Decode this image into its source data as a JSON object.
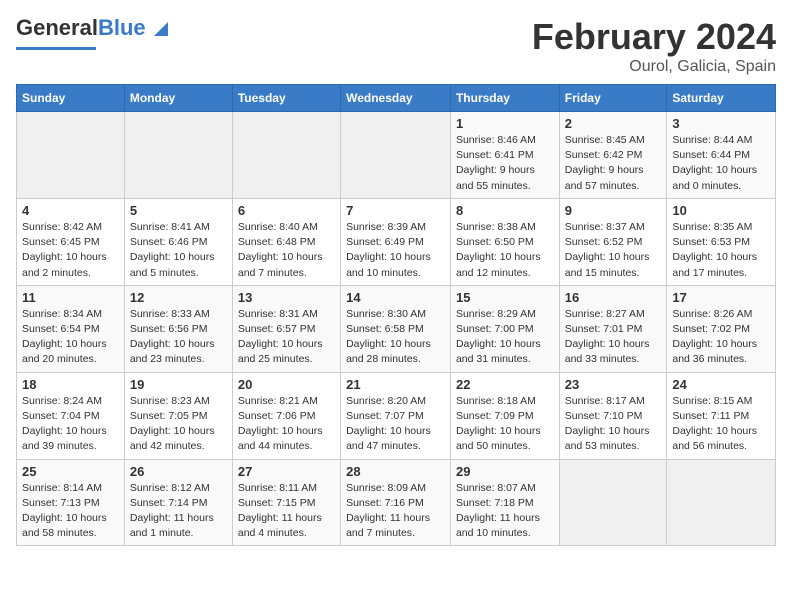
{
  "logo": {
    "part1": "General",
    "part2": "Blue"
  },
  "title": "February 2024",
  "subtitle": "Ourol, Galicia, Spain",
  "days_of_week": [
    "Sunday",
    "Monday",
    "Tuesday",
    "Wednesday",
    "Thursday",
    "Friday",
    "Saturday"
  ],
  "weeks": [
    [
      {
        "day": "",
        "info": ""
      },
      {
        "day": "",
        "info": ""
      },
      {
        "day": "",
        "info": ""
      },
      {
        "day": "",
        "info": ""
      },
      {
        "day": "1",
        "info": "Sunrise: 8:46 AM\nSunset: 6:41 PM\nDaylight: 9 hours and 55 minutes."
      },
      {
        "day": "2",
        "info": "Sunrise: 8:45 AM\nSunset: 6:42 PM\nDaylight: 9 hours and 57 minutes."
      },
      {
        "day": "3",
        "info": "Sunrise: 8:44 AM\nSunset: 6:44 PM\nDaylight: 10 hours and 0 minutes."
      }
    ],
    [
      {
        "day": "4",
        "info": "Sunrise: 8:42 AM\nSunset: 6:45 PM\nDaylight: 10 hours and 2 minutes."
      },
      {
        "day": "5",
        "info": "Sunrise: 8:41 AM\nSunset: 6:46 PM\nDaylight: 10 hours and 5 minutes."
      },
      {
        "day": "6",
        "info": "Sunrise: 8:40 AM\nSunset: 6:48 PM\nDaylight: 10 hours and 7 minutes."
      },
      {
        "day": "7",
        "info": "Sunrise: 8:39 AM\nSunset: 6:49 PM\nDaylight: 10 hours and 10 minutes."
      },
      {
        "day": "8",
        "info": "Sunrise: 8:38 AM\nSunset: 6:50 PM\nDaylight: 10 hours and 12 minutes."
      },
      {
        "day": "9",
        "info": "Sunrise: 8:37 AM\nSunset: 6:52 PM\nDaylight: 10 hours and 15 minutes."
      },
      {
        "day": "10",
        "info": "Sunrise: 8:35 AM\nSunset: 6:53 PM\nDaylight: 10 hours and 17 minutes."
      }
    ],
    [
      {
        "day": "11",
        "info": "Sunrise: 8:34 AM\nSunset: 6:54 PM\nDaylight: 10 hours and 20 minutes."
      },
      {
        "day": "12",
        "info": "Sunrise: 8:33 AM\nSunset: 6:56 PM\nDaylight: 10 hours and 23 minutes."
      },
      {
        "day": "13",
        "info": "Sunrise: 8:31 AM\nSunset: 6:57 PM\nDaylight: 10 hours and 25 minutes."
      },
      {
        "day": "14",
        "info": "Sunrise: 8:30 AM\nSunset: 6:58 PM\nDaylight: 10 hours and 28 minutes."
      },
      {
        "day": "15",
        "info": "Sunrise: 8:29 AM\nSunset: 7:00 PM\nDaylight: 10 hours and 31 minutes."
      },
      {
        "day": "16",
        "info": "Sunrise: 8:27 AM\nSunset: 7:01 PM\nDaylight: 10 hours and 33 minutes."
      },
      {
        "day": "17",
        "info": "Sunrise: 8:26 AM\nSunset: 7:02 PM\nDaylight: 10 hours and 36 minutes."
      }
    ],
    [
      {
        "day": "18",
        "info": "Sunrise: 8:24 AM\nSunset: 7:04 PM\nDaylight: 10 hours and 39 minutes."
      },
      {
        "day": "19",
        "info": "Sunrise: 8:23 AM\nSunset: 7:05 PM\nDaylight: 10 hours and 42 minutes."
      },
      {
        "day": "20",
        "info": "Sunrise: 8:21 AM\nSunset: 7:06 PM\nDaylight: 10 hours and 44 minutes."
      },
      {
        "day": "21",
        "info": "Sunrise: 8:20 AM\nSunset: 7:07 PM\nDaylight: 10 hours and 47 minutes."
      },
      {
        "day": "22",
        "info": "Sunrise: 8:18 AM\nSunset: 7:09 PM\nDaylight: 10 hours and 50 minutes."
      },
      {
        "day": "23",
        "info": "Sunrise: 8:17 AM\nSunset: 7:10 PM\nDaylight: 10 hours and 53 minutes."
      },
      {
        "day": "24",
        "info": "Sunrise: 8:15 AM\nSunset: 7:11 PM\nDaylight: 10 hours and 56 minutes."
      }
    ],
    [
      {
        "day": "25",
        "info": "Sunrise: 8:14 AM\nSunset: 7:13 PM\nDaylight: 10 hours and 58 minutes."
      },
      {
        "day": "26",
        "info": "Sunrise: 8:12 AM\nSunset: 7:14 PM\nDaylight: 11 hours and 1 minute."
      },
      {
        "day": "27",
        "info": "Sunrise: 8:11 AM\nSunset: 7:15 PM\nDaylight: 11 hours and 4 minutes."
      },
      {
        "day": "28",
        "info": "Sunrise: 8:09 AM\nSunset: 7:16 PM\nDaylight: 11 hours and 7 minutes."
      },
      {
        "day": "29",
        "info": "Sunrise: 8:07 AM\nSunset: 7:18 PM\nDaylight: 11 hours and 10 minutes."
      },
      {
        "day": "",
        "info": ""
      },
      {
        "day": "",
        "info": ""
      }
    ]
  ]
}
